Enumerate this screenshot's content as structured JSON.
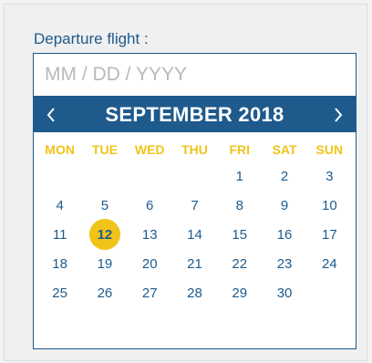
{
  "form": {
    "label": "Departure flight :",
    "date_placeholder": "MM / DD / YYYY",
    "date_value": ""
  },
  "calendar": {
    "month_title": "SEPTEMBER 2018",
    "prev_icon": "chevron-left-icon",
    "next_icon": "chevron-right-icon",
    "weekdays": [
      "MON",
      "TUE",
      "WED",
      "THU",
      "FRI",
      "SAT",
      "SUN"
    ],
    "weeks": [
      [
        "",
        "",
        "",
        "",
        "1",
        "2",
        "3"
      ],
      [
        "4",
        "5",
        "6",
        "7",
        "8",
        "9",
        "10"
      ],
      [
        "11",
        "12",
        "13",
        "14",
        "15",
        "16",
        "17"
      ],
      [
        "18",
        "19",
        "20",
        "21",
        "22",
        "23",
        "24"
      ],
      [
        "25",
        "26",
        "27",
        "28",
        "29",
        "30",
        ""
      ]
    ],
    "selected_day": "12"
  },
  "colors": {
    "primary": "#1e5a8c",
    "accent": "#f0c419",
    "placeholder": "#b9b9b9"
  }
}
